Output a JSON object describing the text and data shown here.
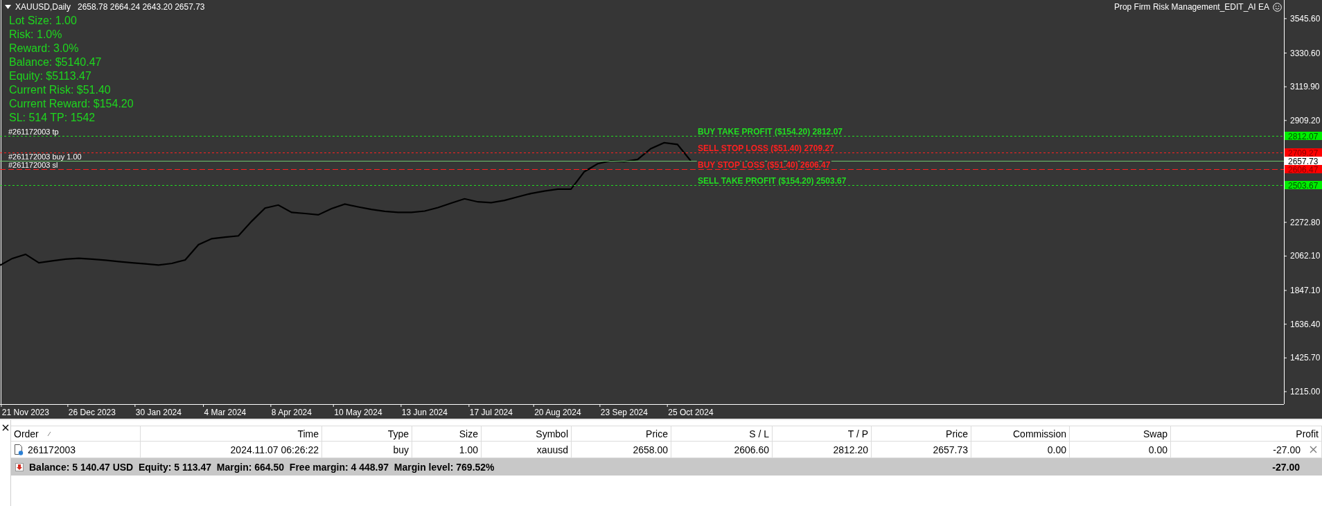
{
  "chart": {
    "header": {
      "symbol": "XAUUSD,Daily",
      "ohlc": "2658.78 2664.24 2643.20 2657.73"
    },
    "expert": {
      "name": "Prop Firm Risk Management_EDIT_AI EA"
    },
    "info_lines": [
      "Lot Size: 1.00",
      "Risk: 1.0%",
      "Reward: 3.0%",
      "Balance: $5140.47",
      "Equity: $5113.47",
      "Current Risk: $51.40",
      "Current Reward: $154.20",
      "SL: 514 TP: 1542"
    ],
    "chart_data": {
      "type": "line",
      "categories": [
        null,
        null,
        "21 Nov 2023",
        null,
        null,
        null,
        null,
        "26 Dec 2023",
        null,
        null,
        null,
        null,
        "30 Jan 2024",
        null,
        null,
        null,
        null,
        "4 Mar 2024",
        null,
        null,
        null,
        null,
        "8 Apr 2024",
        null,
        null,
        null,
        null,
        "10 May 2024",
        null,
        null,
        null,
        null,
        "13 Jun 2024",
        null,
        null,
        null,
        null,
        "17 Jul 2024",
        null,
        null,
        null,
        null,
        "20 Aug 2024",
        null,
        null,
        null,
        null,
        "23 Sep 2024",
        null,
        null,
        null,
        null,
        "25 Oct 2024"
      ],
      "series": [
        {
          "color": "#000000",
          "values": [
            2000,
            2047,
            2073,
            2020,
            2032,
            2043,
            2048,
            2043,
            2036,
            2028,
            2020,
            2013,
            2006,
            2016,
            2038,
            2133,
            2171,
            2180,
            2188,
            2280,
            2362,
            2381,
            2335,
            2328,
            2320,
            2359,
            2387,
            2369,
            2353,
            2342,
            2335,
            2335,
            2343,
            2365,
            2393,
            2420,
            2401,
            2396,
            2410,
            2432,
            2453,
            2468,
            2480,
            2480,
            2589,
            2639,
            2657,
            2652,
            2665,
            2733,
            2770,
            2760,
            2657
          ]
        }
      ],
      "ylim": [
        1137,
        3662
      ],
      "ref_lines": [
        {
          "axis": "y",
          "value": 2812.07,
          "color": "#22dd22"
        },
        {
          "axis": "y",
          "value": 2709.27,
          "color": "#ff2020"
        },
        {
          "axis": "y",
          "value": 2657.73,
          "color": "#6cc46c"
        },
        {
          "axis": "y",
          "value": 2606.47,
          "color": "#ff2020"
        },
        {
          "axis": "y",
          "value": 2503.67,
          "color": "#22dd22"
        }
      ],
      "yticks": [
        {
          "value": 3545.6,
          "label": "3545.60"
        },
        {
          "value": 3330.6,
          "label": "3330.60"
        },
        {
          "value": 3119.9,
          "label": "3119.90"
        },
        {
          "value": 2909.2,
          "label": "2909.20"
        },
        {
          "value": 2272.8,
          "label": "2272.80"
        },
        {
          "value": 2062.1,
          "label": "2062.10"
        },
        {
          "value": 1847.1,
          "label": "1847.10"
        },
        {
          "value": 1636.4,
          "label": "1636.40"
        },
        {
          "value": 1425.7,
          "label": "1425.70"
        },
        {
          "value": 1215,
          "label": "1215.00"
        }
      ]
    },
    "price_levels": [
      {
        "kind": "take_profit",
        "order_label": "#261172003 tp",
        "label": "BUY TAKE PROFIT ($154.20) 2812.07",
        "tag": "2812.07"
      },
      {
        "kind": "stop_loss",
        "label": "SELL STOP LOSS ($51.40) 2709.27",
        "tag": "2709.27"
      },
      {
        "kind": "bid",
        "order_label": "#261172003 buy 1.00",
        "tag": "2657.73"
      },
      {
        "kind": "order_stop_loss",
        "order_label": "#261172003 sl",
        "label": "BUY STOP LOSS ($51.40) 2606.47",
        "tag": "2606.47"
      },
      {
        "kind": "take_profit",
        "label": "SELL TAKE PROFIT ($154.20) 2503.67",
        "tag": "2503.67"
      }
    ]
  },
  "trade_panel": {
    "columns": [
      {
        "label": "Order",
        "sorted": true
      },
      {
        "label": "Time",
        "sorted": false
      },
      {
        "label": "Type",
        "sorted": false
      },
      {
        "label": "Size",
        "sorted": false
      },
      {
        "label": "Symbol",
        "sorted": false
      },
      {
        "label": "Price",
        "sorted": false
      },
      {
        "label": "S / L",
        "sorted": false
      },
      {
        "label": "T / P",
        "sorted": false
      },
      {
        "label": "Price",
        "sorted": false
      },
      {
        "label": "Commission",
        "sorted": false
      },
      {
        "label": "Swap",
        "sorted": false
      },
      {
        "label": "Profit",
        "sorted": false
      }
    ],
    "rows": [
      {
        "cells": [
          "261172003",
          "2024.11.07 06:26:22",
          "buy",
          "1.00",
          "xauusd",
          "2658.00",
          "2606.60",
          "2812.20",
          "2657.73",
          "0.00",
          "0.00",
          "-27.00"
        ]
      }
    ],
    "summary": {
      "text": "Balance: 5 140.47 USD  Equity: 5 113.47  Margin: 664.50  Free margin: 4 448.97  Margin level: 769.52%",
      "profit": "-27.00"
    }
  }
}
